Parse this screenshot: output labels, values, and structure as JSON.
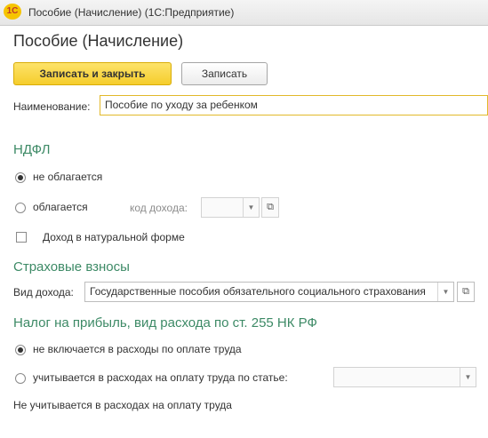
{
  "window": {
    "title": "Пособие (Начисление)  (1С:Предприятие)",
    "logo_text": "1С"
  },
  "page_title": "Пособие (Начисление)",
  "toolbar": {
    "save_close_label": "Записать и закрыть",
    "save_label": "Записать"
  },
  "name_field": {
    "label": "Наименование:",
    "value": "Пособие по уходу за ребенком"
  },
  "ndfl": {
    "title": "НДФЛ",
    "options": [
      {
        "label": "не облагается",
        "selected": true
      },
      {
        "label": "облагается",
        "selected": false
      }
    ],
    "income_code_label": "код дохода:",
    "income_code_value": "",
    "in_kind_label": "Доход в натуральной форме",
    "in_kind_checked": false
  },
  "insurance": {
    "title": "Страховые взносы",
    "income_type_label": "Вид дохода:",
    "income_type_value": "Государственные пособия обязательного социального страхования"
  },
  "profit_tax": {
    "title": "Налог на прибыль, вид расхода по ст. 255 НК РФ",
    "options": [
      {
        "label": "не включается в расходы по оплате труда",
        "selected": true
      },
      {
        "label": "учитывается в расходах на оплату труда по статье:",
        "selected": false
      }
    ],
    "article_value": "",
    "note": "Не учитывается в расходах на оплату труда"
  },
  "icons": {
    "dropdown": "chevron-down-icon",
    "open": "open-form-icon"
  }
}
